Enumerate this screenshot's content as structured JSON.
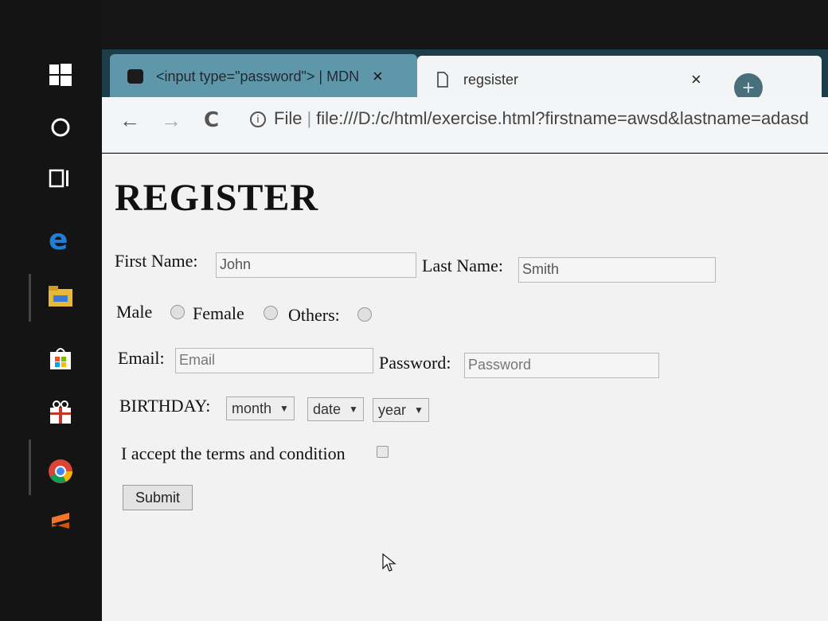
{
  "browser": {
    "tabs": [
      {
        "title": "<input type=\"password\"> | MDN",
        "close": "×"
      },
      {
        "title": "regsister",
        "close": "×"
      }
    ],
    "new_tab": "+",
    "nav": {
      "back": "←",
      "forward": "→",
      "reload": "C"
    },
    "address": {
      "prefix": "File",
      "url": "file:///D:/c/html/exercise.html?firstname=awsd&lastname=adasd"
    }
  },
  "page": {
    "heading": "REGISTER",
    "first_name": {
      "label": "First Name:",
      "value": "John"
    },
    "last_name": {
      "label": "Last Name:",
      "value": "Smith"
    },
    "gender": {
      "male": "Male",
      "female": "Female",
      "others": "Others:"
    },
    "email": {
      "label": "Email:",
      "placeholder": "Email"
    },
    "password": {
      "label": "Password:",
      "placeholder": "Password"
    },
    "birthday": {
      "label": "BIRTHDAY:",
      "month": "month",
      "date": "date",
      "year": "year",
      "arrow": "▼"
    },
    "terms": {
      "label": "I accept the terms and condition"
    },
    "submit": "Submit"
  },
  "taskbar": {
    "icons": [
      "windows-icon",
      "cortana-icon",
      "task-view-icon",
      "edge-icon",
      "file-explorer-icon",
      "store-icon",
      "gift-icon",
      "chrome-icon",
      "sublime-icon"
    ]
  }
}
